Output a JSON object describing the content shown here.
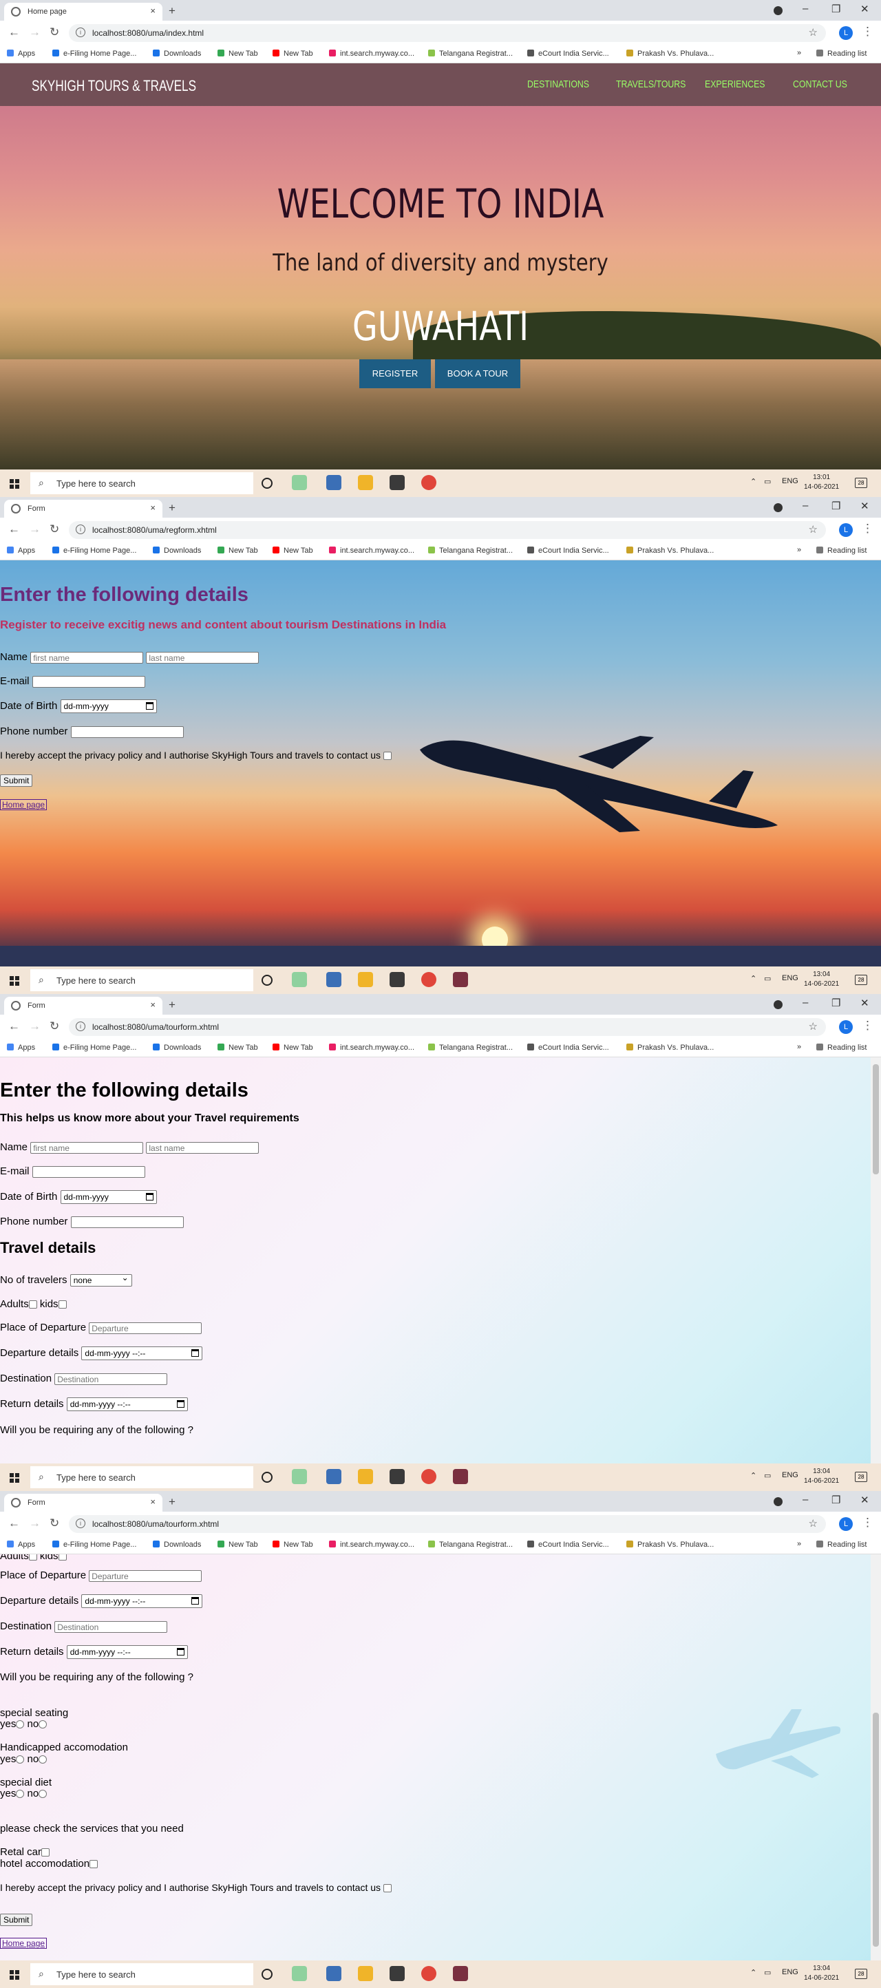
{
  "browser": {
    "bookmarks": [
      "Apps",
      "e-Filing Home Page...",
      "Downloads",
      "New Tab",
      "New Tab",
      "int.search.myway.co...",
      "Telangana Registrat...",
      "eCourt India Servic...",
      "Prakash Vs. Phulava..."
    ],
    "more": "»",
    "reading_list": "Reading list",
    "profile_initial": "L"
  },
  "taskbar": {
    "search_placeholder": "Type here to search",
    "lang": "ENG",
    "badge": "28"
  },
  "screens": [
    {
      "tab_title": "Home page",
      "url": "localhost:8080/uma/index.html",
      "time": "13:01",
      "date": "14-06-2021"
    },
    {
      "tab_title": "Form",
      "url": "localhost:8080/uma/regform.xhtml",
      "time": "13:04",
      "date": "14-06-2021"
    },
    {
      "tab_title": "Form",
      "url": "localhost:8080/uma/tourform.xhtml",
      "time": "13:04",
      "date": "14-06-2021"
    },
    {
      "tab_title": "Form",
      "url": "localhost:8080/uma/tourform.xhtml",
      "time": "13:04",
      "date": "14-06-2021"
    }
  ],
  "home": {
    "brand": "SKYHIGH TOURS & TRAVELS",
    "menu": [
      "DESTINATIONS",
      "TRAVELS/TOURS",
      "EXPERIENCES",
      "CONTACT US"
    ],
    "title": "WELCOME TO INDIA",
    "tagline": "The land of diversity and mystery",
    "city": "GUWAHATI",
    "register": "REGISTER",
    "book": "BOOK A TOUR"
  },
  "regform": {
    "heading": "Enter the following details",
    "subheading": "Register to receive excitig news and content about tourism Destinations in India",
    "name_label": "Name",
    "first_ph": "first name",
    "last_ph": "last name",
    "email_label": "E-mail",
    "dob_label": "Date of Birth",
    "dob_value": "dd-mm-yyyy",
    "phone_label": "Phone number",
    "consent": "I hereby accept the privacy policy and I authorise SkyHigh Tours and travels to contact us",
    "submit": "Submit",
    "home_link": "Home page"
  },
  "tourform": {
    "heading": "Enter the following details",
    "subheading": "This helps us know more about your Travel requirements",
    "name_label": "Name",
    "first_ph": "first name",
    "last_ph": "last name",
    "email_label": "E-mail",
    "dob_label": "Date of Birth",
    "dob_value": "dd-mm-yyyy",
    "phone_label": "Phone number",
    "travel_heading": "Travel details",
    "travelers_label": "No of travelers",
    "travelers_value": "none",
    "adults_label": "Adults",
    "kids_label": "kids",
    "departure_place_label": "Place of Departure",
    "departure_place_ph": "Departure",
    "departure_details_label": "Departure details",
    "datetime_value": "dd-mm-yyyy --:--",
    "destination_label": "Destination",
    "destination_ph": "Destination",
    "return_label": "Return details",
    "requiring": "Will you be requiring any of the following ?",
    "special_seating": "special seating",
    "handicapped": "Handicapped accomodation",
    "special_diet": "special diet",
    "yes": "yes",
    "no": "no",
    "services": "please check the services that you need",
    "rental_car": "Retal car",
    "hotel": "hotel accomodation",
    "consent": "I hereby accept the privacy policy and I authorise SkyHigh Tours and travels to contact us",
    "submit": "Submit",
    "home_link": "Home page"
  }
}
